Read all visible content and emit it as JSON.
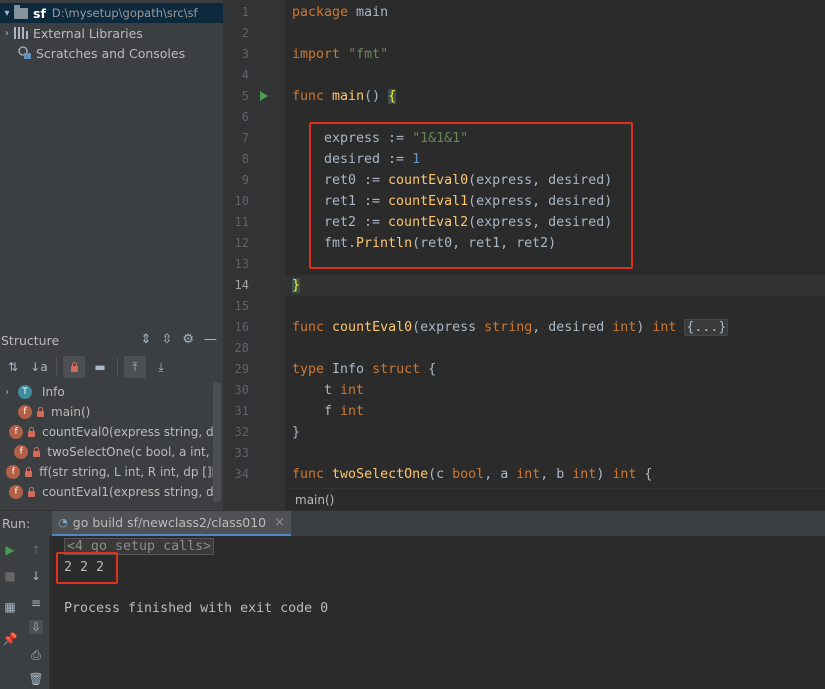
{
  "project": {
    "root_name": "sf",
    "root_path": "D:\\mysetup\\gopath\\src\\sf",
    "external_libraries": "External Libraries",
    "scratches": "Scratches and Consoles"
  },
  "structure": {
    "title": "Structure",
    "items": [
      {
        "badge": "T",
        "label": "Info"
      },
      {
        "badge": "f",
        "label": "main()"
      },
      {
        "badge": "f",
        "label": "countEval0(express string, de"
      },
      {
        "badge": "f",
        "label": "twoSelectOne(c bool, a int, b"
      },
      {
        "badge": "f",
        "label": "ff(str string, L int, R int, dp [][]"
      },
      {
        "badge": "f",
        "label": "countEval1(express string, de"
      }
    ]
  },
  "editor": {
    "line_numbers": [
      "1",
      "2",
      "3",
      "4",
      "5",
      "6",
      "7",
      "8",
      "9",
      "10",
      "11",
      "12",
      "13",
      "14",
      "15",
      "16",
      "28",
      "29",
      "30",
      "31",
      "32",
      "33",
      "34"
    ],
    "fold_placeholder": "{...}",
    "breadcrumb": "main()"
  },
  "run": {
    "label": "Run:",
    "tab": "go build sf/newclass2/class010",
    "folded_calls": "<4 go setup calls>",
    "output": "2 2 2",
    "finish": "Process finished with exit code 0"
  },
  "colors": {
    "keyword": "#cc7832",
    "string": "#6a8759",
    "number": "#6897bb",
    "function": "#ffc66d",
    "highlight_box": "#e0301e"
  }
}
